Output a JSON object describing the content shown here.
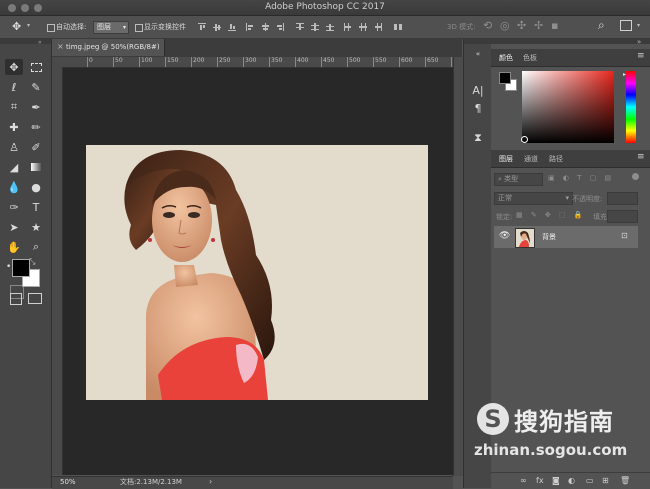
{
  "window": {
    "title": "Adobe Photoshop CC 2017"
  },
  "options_bar": {
    "move_icon": "move-arrows-icon",
    "auto_select_label": "自动选择:",
    "auto_select_value": "图层",
    "show_transform_label": "显示变换控件",
    "mode_3d_label": "3D 模式:"
  },
  "document": {
    "tab_label": "timg.jpeg @ 50%(RGB/8#)",
    "close_glyph": "×",
    "ruler_ticks": [
      "0",
      "50",
      "100",
      "150",
      "200",
      "250",
      "300",
      "350",
      "400",
      "450",
      "500",
      "550",
      "600",
      "650",
      "700"
    ]
  },
  "status_bar": {
    "zoom": "50%",
    "doc_size": "文档:2.13M/2.13M",
    "arrow": "›"
  },
  "color_panel": {
    "tabs": [
      "颜色",
      "色板"
    ],
    "foreground": "#000000",
    "background": "#ffffff",
    "picker_hue": "#e8261c"
  },
  "layers_panel": {
    "tabs": [
      "图层",
      "通道",
      "路径"
    ],
    "kind_filter": "类型",
    "blend_mode": "正常",
    "opacity_label": "不透明度:",
    "lock_label": "锁定:",
    "fill_label": "填充:",
    "layers": [
      {
        "name": "背景",
        "visible": true,
        "locked": true
      }
    ],
    "footer_icons": [
      "link-icon",
      "fx-icon",
      "mask-icon",
      "adjustment-icon",
      "folder-icon",
      "new-layer-icon",
      "trash-icon"
    ],
    "fx_label": "fx"
  },
  "watermark": {
    "logo_letter": "S",
    "brand": "搜狗指南",
    "url": "zhinan.sogou.com"
  }
}
